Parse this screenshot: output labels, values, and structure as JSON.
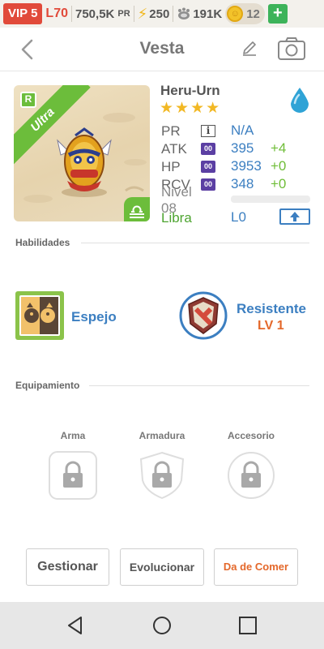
{
  "status": {
    "vip": "VIP 5",
    "level": "L70",
    "power": "750,5K",
    "power_unit": "PR",
    "energy": "250",
    "food": "191K",
    "coins": "12",
    "plus": "+"
  },
  "header": {
    "title": "Vesta"
  },
  "hero": {
    "name": "Heru-Urn",
    "rarity": "Ultra",
    "rarity_badge": "R",
    "stars": 4,
    "element_icon": "water-drop-icon",
    "stats": [
      {
        "label": "PR",
        "tag": "i",
        "value": "N/A",
        "bonus": ""
      },
      {
        "label": "ATK",
        "tag": "00",
        "value": "395",
        "bonus": "+4"
      },
      {
        "label": "HP",
        "tag": "00",
        "value": "3953",
        "bonus": "+0"
      },
      {
        "label": "RCV",
        "tag": "00",
        "value": "348",
        "bonus": "+0"
      }
    ],
    "level_label": "Nivel 08",
    "level_progress": 0,
    "sign": "Libra",
    "sign_level": "L0"
  },
  "skills": {
    "section_title": "Habilidades",
    "items": [
      {
        "name": "Espejo",
        "level": ""
      },
      {
        "name": "Resistente",
        "level": "LV 1"
      }
    ]
  },
  "equipment": {
    "section_title": "Equipamiento",
    "slots": [
      {
        "label": "Arma"
      },
      {
        "label": "Armadura"
      },
      {
        "label": "Accesorio"
      }
    ]
  },
  "actions": {
    "manage": "Gestionar",
    "evolve": "Evolucionar",
    "feed": "Da de Comer"
  },
  "colors": {
    "accent_blue": "#3c7fc1",
    "accent_green": "#6cbd3b",
    "accent_red": "#e14a3a",
    "accent_orange": "#e4682b"
  }
}
